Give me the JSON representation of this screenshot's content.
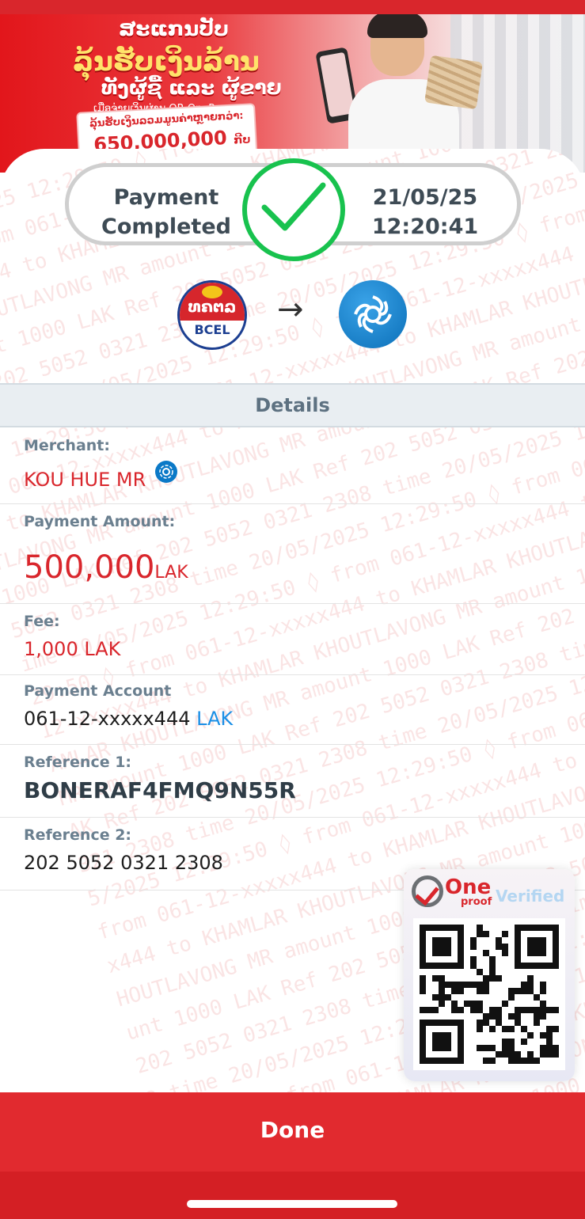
{
  "banner": {
    "line1": "ສະແກນປັບ",
    "line2": "ລຸ້ນຮັບເງິນລ້ານ",
    "line3": "ທັງຜູ້ຊື້ ແລະ ຜູ້ຂາຍ",
    "line4": "ເມື່ອຈ່າຍເງິນຜ່ານ QR OnePay",
    "promo_label": "ລຸ້ນຮັບເງິນລວມມູນຄ່າຫຼາຍກວ່າ:",
    "promo_amount": "650,000,000",
    "promo_unit": "ກີບ"
  },
  "status": {
    "label": "Payment Completed",
    "date": "21/05/25",
    "time": "12:20:41",
    "success_color": "#18c24e"
  },
  "transfer": {
    "from_bank_lao": "ທຄຕລ",
    "from_bank_code": "BCEL",
    "arrow_icon": "arrow-right-icon",
    "to_logo_icon": "onepay-logo-icon"
  },
  "details": {
    "header": "Details",
    "merchant_label": "Merchant:",
    "merchant_value": "KOU HUE MR",
    "amount_label": "Payment Amount:",
    "amount_value": "500,000",
    "amount_currency": "LAK",
    "fee_label": "Fee:",
    "fee_value": "1,000 LAK",
    "account_label": "Payment Account",
    "account_value": "061-12-xxxxx444",
    "account_currency": "LAK",
    "ref1_label": "Reference 1:",
    "ref1_value": "BONERAF4FMQ9N55R",
    "ref2_label": "Reference 2:",
    "ref2_value": "202 5052 0321 2308"
  },
  "watermark_text": "20/05/2025 12:29:50 ◊ from 061-12-xxxxx444 to KHAMLAR KHOUTLAVONG MR amount 1000 LAK Ref 202 5052 0321 2308 time",
  "oneproof": {
    "name": "One",
    "sub": "proof",
    "verified": "Verified"
  },
  "actions": {
    "done": "Done"
  },
  "colors": {
    "brand_red": "#d9262c",
    "label_gray": "#6a7f8f",
    "link_blue": "#1a8fe6"
  }
}
